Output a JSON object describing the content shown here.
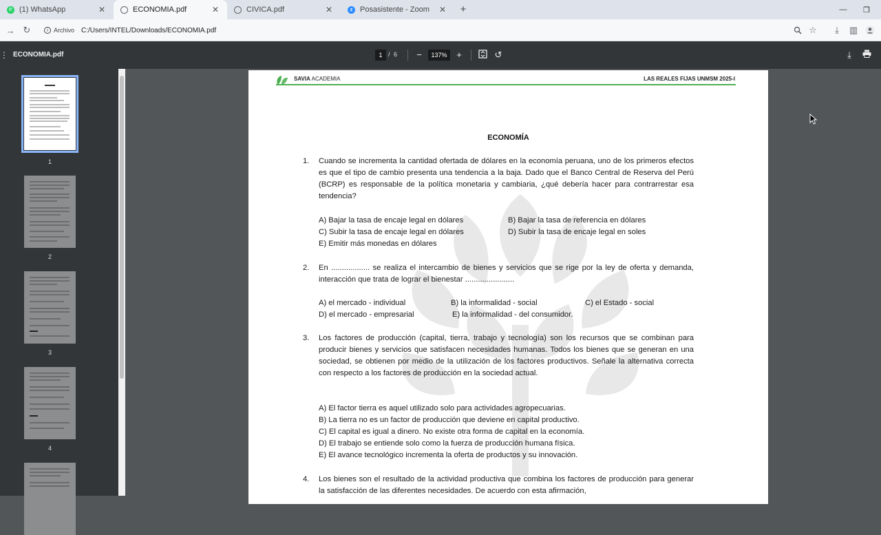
{
  "tabs": [
    {
      "title": "(1) WhatsApp",
      "favicon": "whatsapp-icon",
      "color": "#25d366"
    },
    {
      "title": "ECONOMIA.pdf",
      "favicon": "globe-icon",
      "color": "#5f6368"
    },
    {
      "title": "CIVICA.pdf",
      "favicon": "globe-icon",
      "color": "#5f6368"
    },
    {
      "title": "Posasistente - Zoom",
      "favicon": "zoom-icon",
      "color": "#2d8cff"
    }
  ],
  "address": {
    "info_label": "Archivo",
    "url": "C:/Users/INTEL/Downloads/ECONOMIA.pdf"
  },
  "pdf": {
    "filename": "ECONOMIA.pdf",
    "current_page": "1",
    "page_sep": "/",
    "total_pages": "6",
    "zoom": "137%"
  },
  "thumbnails": [
    {
      "label": "1"
    },
    {
      "label": "2"
    },
    {
      "label": "3"
    },
    {
      "label": "4"
    }
  ],
  "document": {
    "header_brand_bold": "SAVIA",
    "header_brand_rest": " ACADEMIA",
    "header_right": "LAS REALES FIJAS UNMSM 2025-I",
    "accent_color": "#4caf50",
    "title": "ECONOMÍA",
    "questions": [
      {
        "num": "1.",
        "text": "Cuando se incrementa la cantidad ofertada de dólares en la economía peruana, uno de los primeros efectos es que el tipo de cambio presenta una tendencia a la baja. Dado que el Banco Central de Reserva del Perú (BCRP) es responsable de la política monetaria y cambiaria, ¿qué debería hacer para contrarrestar esa tendencia?",
        "options": [
          "A) Bajar la tasa de encaje legal en dólares",
          "B) Bajar la tasa de referencia en dólares",
          "C) Subir la tasa de encaje legal en dólares",
          "D) Subir la tasa de encaje legal en soles",
          "E) Emitir más monedas en dólares"
        ]
      },
      {
        "num": "2.",
        "text": "En .................. se realiza el intercambio de bienes y servicios que se rige por la ley de oferta y demanda, interacción que trata de lograr el bienestar .......................",
        "options": [
          "A) el mercado - individual",
          "B) la informalidad - social",
          "C) el Estado - social",
          "D) el mercado - empresarial",
          "E) la informalidad - del consumidor."
        ]
      },
      {
        "num": "3.",
        "text": "Los factores de producción (capital, tierra, trabajo y tecnología) son los recursos que se combinan para producir bienes y servicios que satisfacen necesidades humanas. Todos los bienes que se generan en una sociedad, se obtienen por medio de la utilización de los factores productivos. Señale la alternativa correcta con respecto a los factores de producción en la sociedad actual.",
        "options": [
          "A) El factor tierra es aquel utilizado solo para actividades agropecuarias.",
          "B) La tierra no es un factor de producción que deviene en capital productivo.",
          "C) El capital es igual a dinero. No existe otra forma de capital en la economía.",
          "D) El trabajo se entiende solo como la fuerza de producción humana física.",
          "E) El avance tecnológico incrementa la oferta de productos y su innovación."
        ]
      },
      {
        "num": "4.",
        "text": "Los bienes son el resultado de la actividad productiva que combina los factores de producción para generar la satisfacción de las diferentes necesidades. De acuerdo con esta afirmación,"
      }
    ]
  }
}
